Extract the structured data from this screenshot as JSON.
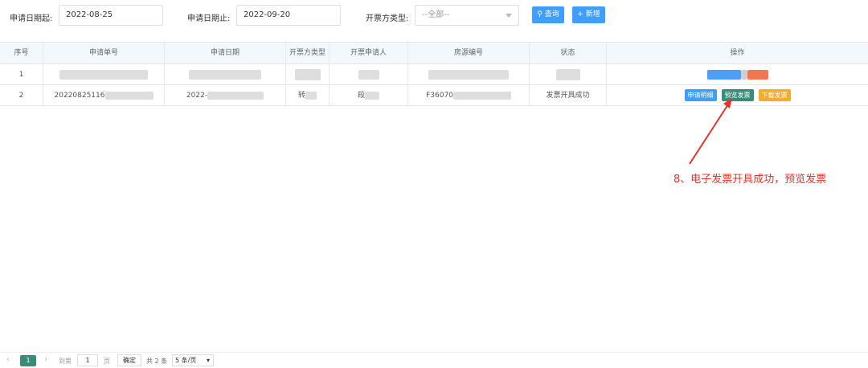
{
  "search": {
    "start_label": "申请日期起:",
    "start_value": "2022-08-25",
    "end_label": "申请日期止:",
    "end_value": "2022-09-20",
    "type_label": "开票方类型:",
    "type_value": "--全部--",
    "query_label": "查询",
    "add_label": "新增"
  },
  "table": {
    "headers": [
      "序号",
      "申请单号",
      "申请日期",
      "开票方类型",
      "开票申请人",
      "房源编号",
      "状态",
      "操作"
    ],
    "rows": [
      {
        "index": "1",
        "order_no": "",
        "date": "",
        "type": "",
        "applicant": "",
        "house_no": "",
        "status": ""
      },
      {
        "index": "2",
        "order_no": "20220825116",
        "date": "2022-",
        "type": "转",
        "applicant": "段",
        "house_no": "F36070",
        "status": "发票开具成功"
      }
    ],
    "actions": {
      "detail": "申请明细",
      "preview": "预览发票",
      "download": "下载发票"
    }
  },
  "annotation": {
    "text": "8、电子发票开具成功，预览发票"
  },
  "pager": {
    "prev_icon": "chevron-left-icon",
    "next_icon": "chevron-right-icon",
    "current_page": "1",
    "goto_label": "到第",
    "goto_value": "1",
    "page_unit": "页",
    "confirm_label": "确定",
    "total_label": "共 2 条",
    "page_size": "5 条/页"
  },
  "colors": {
    "primary": "#409eff",
    "preview": "#3a8b7a",
    "download": "#f0ad2e",
    "annotation": "#e8332a"
  }
}
